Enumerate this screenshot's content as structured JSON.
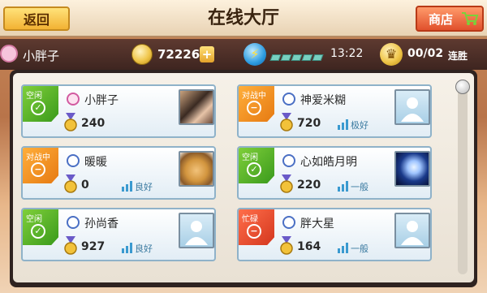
{
  "header": {
    "back_label": "返回",
    "title": "在线大厅",
    "shop_label": "商店"
  },
  "status": {
    "player_name": "小胖子",
    "coins": "72226",
    "plus": "+",
    "energy_glyph": "⚡",
    "time": "13:22",
    "crown_glyph": "♛",
    "streak": "00/02",
    "streak_label": "连胜"
  },
  "colors": {
    "idle": "#3a9a1c",
    "fighting": "#e67a12",
    "busy": "#d4371e"
  },
  "players": [
    {
      "status": "空闲",
      "status_icon": "✓",
      "name": "小胖子",
      "gender": "female",
      "score": "240",
      "signal": "",
      "avatar": "photo-woman"
    },
    {
      "status": "对战中",
      "status_icon": "−",
      "name": "神爱米糊",
      "gender": "male",
      "score": "720",
      "signal": "极好",
      "avatar": "default"
    },
    {
      "status": "对战中",
      "status_icon": "−",
      "name": "暖暖",
      "gender": "male",
      "score": "0",
      "signal": "良好",
      "avatar": "photo-dog"
    },
    {
      "status": "空闲",
      "status_icon": "✓",
      "name": "心如皓月明",
      "gender": "male",
      "score": "220",
      "signal": "一般",
      "avatar": "photo-moon"
    },
    {
      "status": "空闲",
      "status_icon": "✓",
      "name": "孙尚香",
      "gender": "male",
      "score": "927",
      "signal": "良好",
      "avatar": "default"
    },
    {
      "status": "忙碌",
      "status_icon": "−",
      "name": "胖大星",
      "gender": "male",
      "score": "164",
      "signal": "一般",
      "avatar": "default"
    }
  ]
}
